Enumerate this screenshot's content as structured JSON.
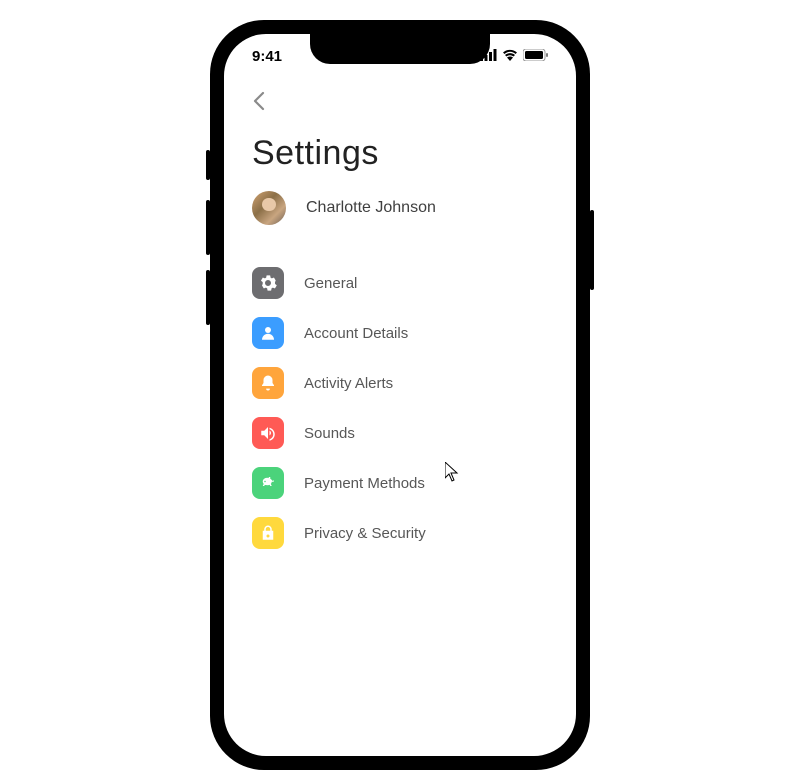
{
  "status_bar": {
    "time": "9:41"
  },
  "page": {
    "title": "Settings"
  },
  "profile": {
    "name": "Charlotte Johnson"
  },
  "items": [
    {
      "label": "General",
      "icon": "gear",
      "color": "gray"
    },
    {
      "label": "Account Details",
      "icon": "person",
      "color": "blue"
    },
    {
      "label": "Activity Alerts",
      "icon": "bell",
      "color": "orange"
    },
    {
      "label": "Sounds",
      "icon": "speaker",
      "color": "red"
    },
    {
      "label": "Payment Methods",
      "icon": "piggy-bank",
      "color": "green"
    },
    {
      "label": "Privacy & Security",
      "icon": "lock",
      "color": "yellow"
    }
  ]
}
